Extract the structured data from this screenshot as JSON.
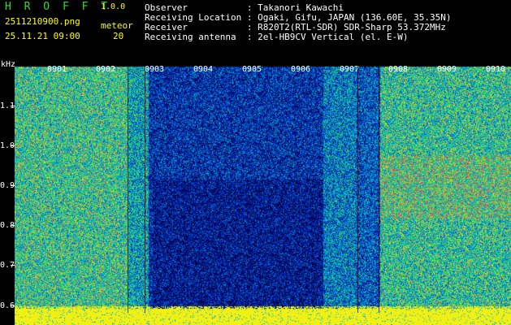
{
  "header": {
    "title": "H R O F F T",
    "version": "1.0.0",
    "filename": "2511210900.png",
    "datetime": "25.11.21 09:00",
    "meteor_label": "meteor",
    "meteor_count": "20",
    "info_lines": [
      "Observer           : Takanori Kawachi",
      "Receiving Location : Ogaki, Gifu, JAPAN (136.60E, 35.35N)",
      "Receiver           : R820T2(RTL-SDR) SDR-Sharp 53.372MHz",
      "Receiving antenna  : 2el-HB9CV Vertical (el. E-W)"
    ]
  },
  "axis": {
    "unit": "kHz",
    "y_labels": [
      "1.1",
      "1.0",
      "0.9",
      "0.8",
      "0.7",
      "0.6"
    ],
    "x_labels": [
      "0901",
      "0902",
      "0903",
      "0904",
      "0905",
      "0906",
      "0907",
      "0908",
      "0909",
      "0910"
    ]
  },
  "colors": {
    "title": "#2fdc2f",
    "info_text": "#ffffff",
    "version": "#ffff00",
    "baseline": "#ffff00"
  }
}
